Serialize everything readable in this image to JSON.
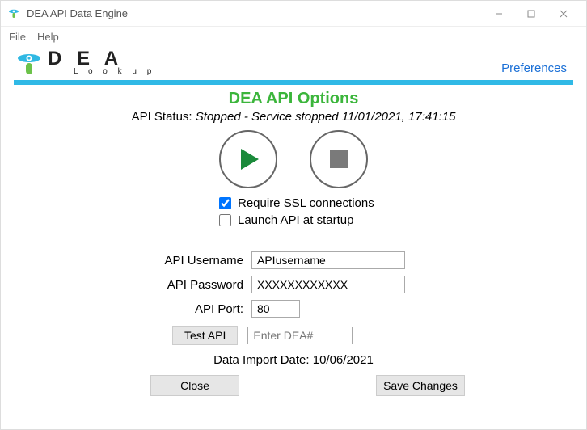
{
  "window": {
    "title": "DEA API Data Engine"
  },
  "menu": {
    "file": "File",
    "help": "Help"
  },
  "logo": {
    "brand_main": "D E A",
    "brand_sub": "L o o k u p"
  },
  "preferences_link": "Preferences",
  "heading": "DEA API Options",
  "status": {
    "label": "API Status:",
    "value": "Stopped - Service stopped  11/01/2021, 17:41:15"
  },
  "checkboxes": {
    "ssl": {
      "label": "Require SSL connections",
      "checked": true
    },
    "startup": {
      "label": "Launch API at startup",
      "checked": false
    }
  },
  "fields": {
    "username": {
      "label": "API Username",
      "value": "APIusername"
    },
    "password": {
      "label": "API Password",
      "value": "XXXXXXXXXXXX"
    },
    "port": {
      "label": "API  Port:",
      "value": "80"
    }
  },
  "test": {
    "button": "Test API",
    "placeholder": "Enter DEA#"
  },
  "import_date": {
    "label": "Data Import Date:",
    "value": "10/06/2021"
  },
  "buttons": {
    "close": "Close",
    "save": "Save Changes"
  }
}
